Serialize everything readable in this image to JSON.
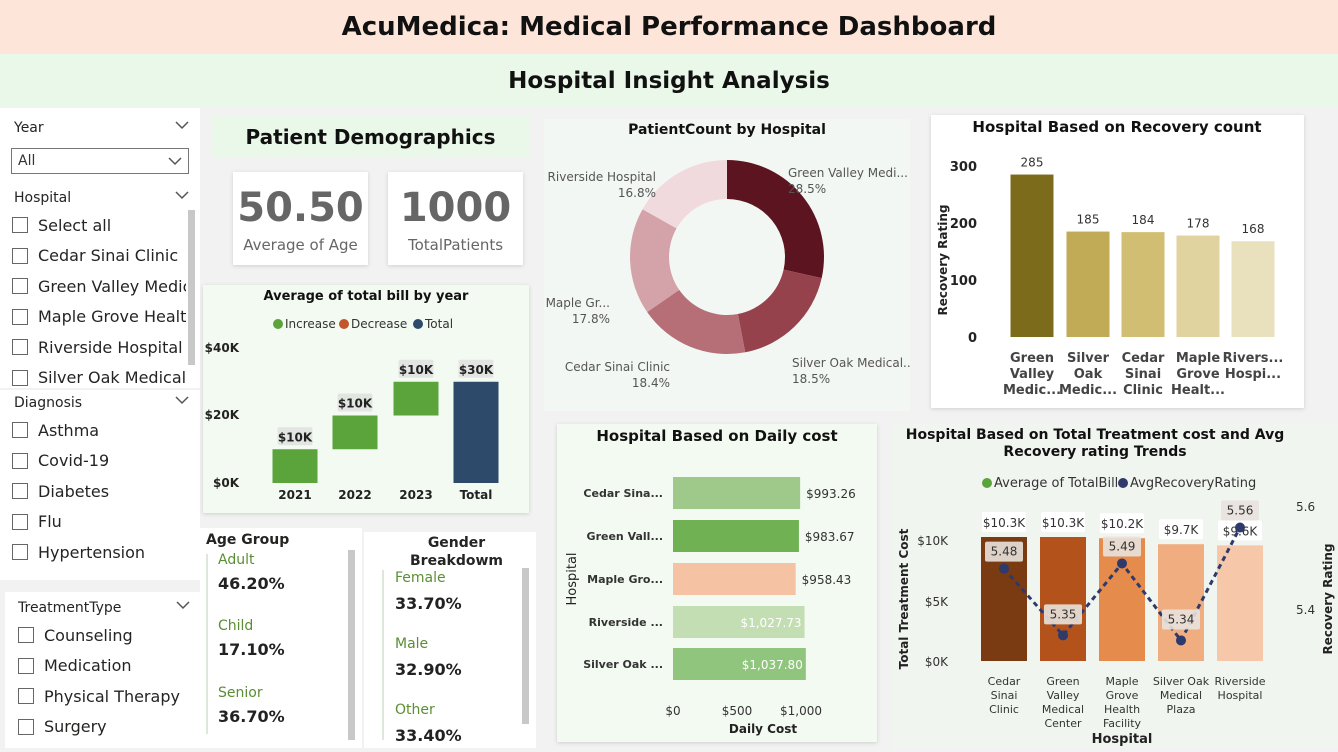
{
  "header": {
    "title": "AcuMedica: Medical Performance Dashboard",
    "subtitle": "Hospital Insight Analysis"
  },
  "year_slicer": {
    "title": "Year",
    "value": "All"
  },
  "hospital_slicer": {
    "title": "Hospital",
    "items": [
      "Select all",
      "Cedar Sinai Clinic",
      "Green Valley Medic...",
      "Maple Grove Healt...",
      "Riverside Hospital",
      "Silver Oak Medical ..."
    ]
  },
  "diagnosis_slicer": {
    "title": "Diagnosis",
    "items": [
      "Asthma",
      "Covid-19",
      "Diabetes",
      "Flu",
      "Hypertension"
    ]
  },
  "treatment_slicer": {
    "title": "TreatmentType",
    "items": [
      "Counseling",
      "Medication",
      "Physical Therapy",
      "Surgery"
    ]
  },
  "demographics": {
    "title": "Patient Demographics",
    "avg_age": {
      "value": "50.50",
      "label": "Average of Age"
    },
    "total_patients": {
      "value": "1000",
      "label": "TotalPatients"
    }
  },
  "age_group": {
    "title": "Age Group",
    "items": [
      {
        "label": "Adult",
        "value": "46.20%"
      },
      {
        "label": "Child",
        "value": "17.10%"
      },
      {
        "label": "Senior",
        "value": "36.70%"
      }
    ]
  },
  "gender": {
    "title_line1": "Gender",
    "title_line2": "Breakdowm",
    "items": [
      {
        "label": "Female",
        "value": "33.70%"
      },
      {
        "label": "Male",
        "value": "32.90%"
      },
      {
        "label": "Other",
        "value": "33.40%"
      }
    ]
  },
  "colors": {
    "increase": "#5ba33b",
    "decrease": "#c0562a",
    "total": "#2d4a6b",
    "accent_green": "#eaf8e9",
    "accent_peach": "#fde5d9"
  },
  "chart_data": [
    {
      "id": "waterfall",
      "type": "bar",
      "title": "Average of total bill by year",
      "legend": [
        "Increase",
        "Decrease",
        "Total"
      ],
      "categories": [
        "2021",
        "2022",
        "2023",
        "Total"
      ],
      "values": [
        10,
        10,
        10,
        30
      ],
      "data_labels": [
        "$10K",
        "$10K",
        "$10K",
        "$30K"
      ],
      "y_ticks": [
        "$40K",
        "$20K",
        "$0K"
      ],
      "ylim": [
        0,
        40
      ]
    },
    {
      "id": "donut",
      "type": "pie",
      "title": "PatientCount by Hospital",
      "slices": [
        {
          "label": "Green Valley Medi...",
          "value": 28.5,
          "pct": "28.5%",
          "color": "#5c1520"
        },
        {
          "label": "Silver Oak Medical...",
          "value": 18.5,
          "pct": "18.5%",
          "color": "#96424d"
        },
        {
          "label": "Cedar Sinai Clinic",
          "value": 18.4,
          "pct": "18.4%",
          "color": "#b66e77"
        },
        {
          "label": "Maple Gr...",
          "value": 17.8,
          "pct": "17.8%",
          "color": "#d4a3a9"
        },
        {
          "label": "Riverside Hospital",
          "value": 16.8,
          "pct": "16.8%",
          "color": "#f0dade"
        }
      ]
    },
    {
      "id": "recovery",
      "type": "bar",
      "title": "Hospital Based on Recovery count",
      "ylabel": "Recovery Rating",
      "categories": [
        [
          "Green",
          "Valley",
          "Medic..."
        ],
        [
          "Silver",
          "Oak",
          "Medic..."
        ],
        [
          "Cedar",
          "Sinai",
          "Clinic"
        ],
        [
          "Maple",
          "Grove",
          "Healt..."
        ],
        [
          "Rivers...",
          "Hospi..."
        ]
      ],
      "values": [
        285,
        185,
        184,
        178,
        168
      ],
      "colors": [
        "#7d6b1c",
        "#c2ab56",
        "#d1be72",
        "#e1d39f",
        "#e9e0be"
      ],
      "y_ticks": [
        300,
        200,
        100,
        0
      ],
      "ylim": [
        0,
        300
      ]
    },
    {
      "id": "daily_cost",
      "type": "bar",
      "title": "Hospital Based on Daily cost",
      "ylabel": "Hospital",
      "xlabel": "Daily Cost",
      "categories": [
        "Cedar Sina...",
        "Green Vall...",
        "Maple Gro...",
        "Riverside ...",
        "Silver Oak ..."
      ],
      "values": [
        993.26,
        983.67,
        958.43,
        1027.73,
        1037.8
      ],
      "data_labels": [
        "$993.26",
        "$983.67",
        "$958.43",
        "$1,027.73",
        "$1,037.80"
      ],
      "colors": [
        "#9ec98a",
        "#6fb153",
        "#f6c2a4",
        "#c4deb4",
        "#8fc57c"
      ],
      "x_ticks": [
        "$0",
        "$500",
        "$1,000"
      ],
      "xlim": [
        0,
        1050
      ]
    },
    {
      "id": "combo",
      "type": "bar",
      "title": "Hospital Based on Total Treatment cost and Avg Recovery rating Trends",
      "title_line1": "Hospital Based on Total Treatment cost and Avg",
      "title_line2": "Recovery rating Trends",
      "legend": [
        "Average of TotalBill",
        "AvgRecoveryRating"
      ],
      "xlabel": "Hospital",
      "ylabel": "Total Treatment Cost",
      "y2label": "Recovery Rating",
      "categories": [
        [
          "Cedar",
          "Sinai",
          "Clinic"
        ],
        [
          "Green",
          "Valley",
          "Medical",
          "Center"
        ],
        [
          "Maple",
          "Grove",
          "Health",
          "Facility"
        ],
        [
          "Silver Oak",
          "Medical",
          "Plaza"
        ],
        [
          "Riverside",
          "Hospital"
        ]
      ],
      "bar_values": [
        10.3,
        10.3,
        10.2,
        9.7,
        9.6
      ],
      "bar_labels": [
        "$10.3K",
        "$10.3K",
        "$10.2K",
        "$9.7K",
        "$9.6K"
      ],
      "bar_colors": [
        "#7a3a12",
        "#b3531b",
        "#e58b4c",
        "#f0ad80",
        "#f6c7a8"
      ],
      "line_values": [
        5.48,
        5.35,
        5.49,
        5.34,
        5.56
      ],
      "line_labels": [
        "5.48",
        "5.35",
        "5.49",
        "5.34",
        "5.56"
      ],
      "y_ticks": [
        "$10K",
        "$5K",
        "$0K"
      ],
      "ylim": [
        0,
        10.3
      ],
      "y2_ticks": [
        "5.6",
        "5.4"
      ],
      "y2lim": [
        5.3,
        5.6
      ]
    }
  ]
}
